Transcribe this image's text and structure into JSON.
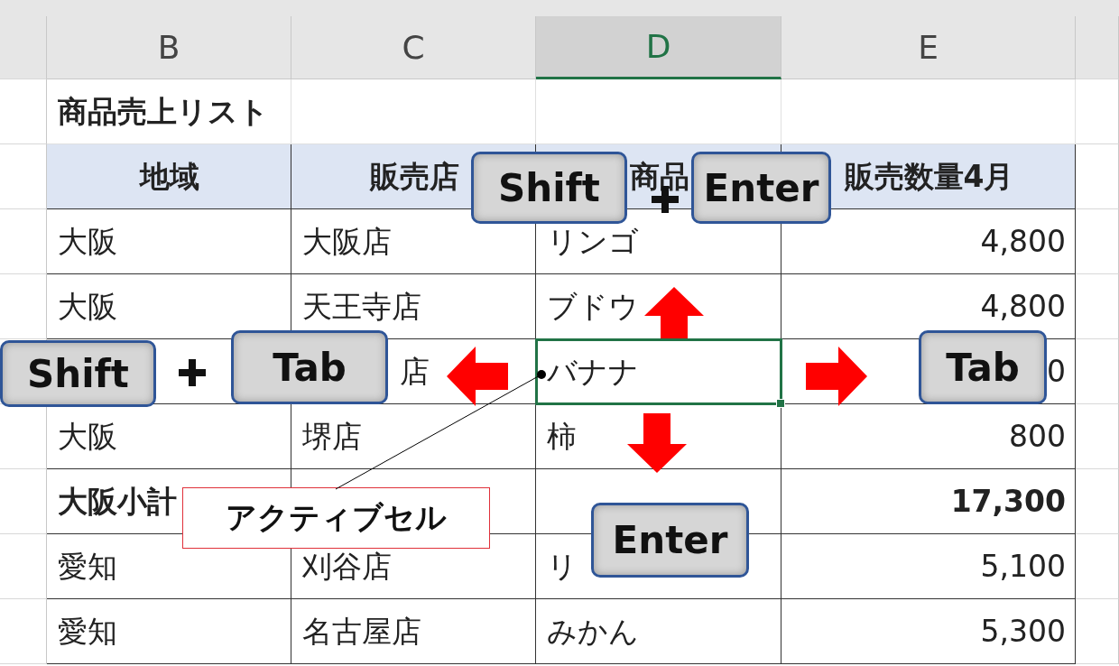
{
  "columns": [
    {
      "label": "B",
      "selected": false
    },
    {
      "label": "C",
      "selected": false
    },
    {
      "label": "D",
      "selected": true
    },
    {
      "label": "E",
      "selected": false
    }
  ],
  "rows": [
    {
      "kind": "title",
      "cells": [
        {
          "text": "商品売上リスト"
        },
        {},
        {},
        {}
      ]
    },
    {
      "kind": "header",
      "cells": [
        {
          "text": "地域"
        },
        {
          "text": "販売店"
        },
        {
          "text": "商品"
        },
        {
          "text": "販売数量4月"
        }
      ]
    },
    {
      "kind": "data",
      "cells": [
        {
          "text": "大阪"
        },
        {
          "text": "大阪店"
        },
        {
          "text": "リンゴ"
        },
        {
          "text": "4,800"
        }
      ]
    },
    {
      "kind": "data",
      "cells": [
        {
          "text": "大阪"
        },
        {
          "text": "天王寺店"
        },
        {
          "text": "ブドウ"
        },
        {
          "text": "4,800"
        }
      ]
    },
    {
      "kind": "data",
      "cells": [
        {},
        {
          "text": "店"
        },
        {
          "text": "バナナ",
          "active": true
        },
        {
          "text": "0"
        }
      ]
    },
    {
      "kind": "data",
      "cells": [
        {
          "text": "大阪"
        },
        {
          "text": "堺店"
        },
        {
          "text": "柿"
        },
        {
          "text": "800"
        }
      ]
    },
    {
      "kind": "subtotal",
      "cells": [
        {
          "text": "大阪小計"
        },
        {},
        {},
        {
          "text": "17,300"
        }
      ]
    },
    {
      "kind": "data",
      "cells": [
        {
          "text": "愛知"
        },
        {
          "text": "刈谷店"
        },
        {
          "text": "リ"
        },
        {
          "text": "5,100"
        }
      ]
    },
    {
      "kind": "data",
      "cells": [
        {
          "text": "愛知"
        },
        {
          "text": "名古屋店"
        },
        {
          "text": "みかん"
        },
        {
          "text": "5,300"
        }
      ]
    }
  ],
  "keys": [
    {
      "label": "Shift"
    },
    {
      "label": "Enter"
    },
    {
      "label": "Shift"
    },
    {
      "label": "Tab"
    },
    {
      "label": "Tab"
    },
    {
      "label": "Enter"
    }
  ],
  "callout": {
    "text": "アクティブセル"
  }
}
